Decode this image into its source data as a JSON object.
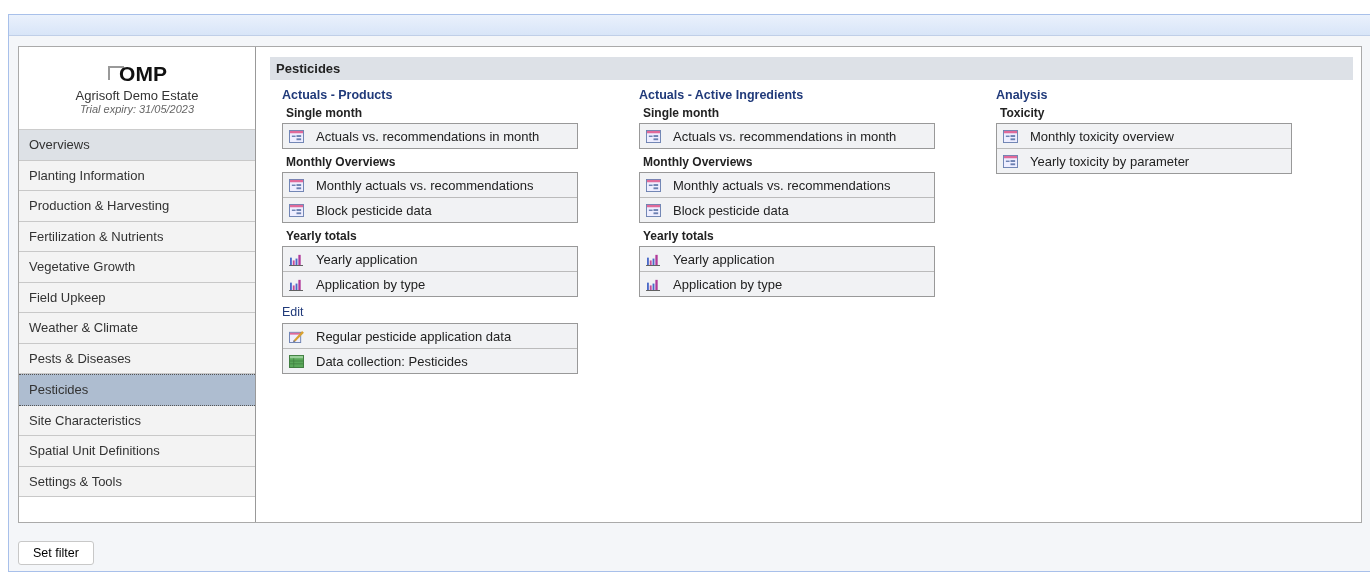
{
  "logo": {
    "text": "OMP"
  },
  "estate": {
    "name": "Agrisoft Demo Estate",
    "trial": "Trial expiry: 31/05/2023"
  },
  "nav": [
    {
      "label": "Overviews",
      "selected": false,
      "hovered": true
    },
    {
      "label": "Planting Information",
      "selected": false,
      "hovered": false
    },
    {
      "label": "Production & Harvesting",
      "selected": false,
      "hovered": false
    },
    {
      "label": "Fertilization & Nutrients",
      "selected": false,
      "hovered": false
    },
    {
      "label": "Vegetative Growth",
      "selected": false,
      "hovered": false
    },
    {
      "label": "Field Upkeep",
      "selected": false,
      "hovered": false
    },
    {
      "label": "Weather & Climate",
      "selected": false,
      "hovered": false
    },
    {
      "label": "Pests & Diseases",
      "selected": false,
      "hovered": false
    },
    {
      "label": "Pesticides",
      "selected": true,
      "hovered": false
    },
    {
      "label": "Site Characteristics",
      "selected": false,
      "hovered": false
    },
    {
      "label": "Spatial Unit Definitions",
      "selected": false,
      "hovered": false
    },
    {
      "label": "Settings & Tools",
      "selected": false,
      "hovered": false
    }
  ],
  "content": {
    "title": "Pesticides",
    "columns": [
      {
        "title": "Actuals - Products",
        "sections": [
          {
            "heading": "Single month",
            "kind": "sub",
            "items": [
              {
                "label": "Actuals vs. recommendations in month",
                "kind": "report"
              }
            ]
          },
          {
            "heading": "Monthly Overviews",
            "kind": "sub",
            "items": [
              {
                "label": "Monthly actuals vs. recommendations",
                "kind": "report"
              },
              {
                "label": "Block pesticide data",
                "kind": "report"
              }
            ]
          },
          {
            "heading": "Yearly totals",
            "kind": "sub",
            "items": [
              {
                "label": "Yearly application",
                "kind": "chart"
              },
              {
                "label": "Application by type",
                "kind": "chart"
              }
            ]
          },
          {
            "heading": "Edit",
            "kind": "group",
            "items": [
              {
                "label": "Regular pesticide application data",
                "kind": "edit"
              },
              {
                "label": "Data collection: Pesticides",
                "kind": "sheet"
              }
            ]
          }
        ]
      },
      {
        "title": "Actuals - Active Ingredients",
        "sections": [
          {
            "heading": "Single month",
            "kind": "sub",
            "items": [
              {
                "label": "Actuals vs. recommendations in month",
                "kind": "report"
              }
            ]
          },
          {
            "heading": "Monthly Overviews",
            "kind": "sub",
            "items": [
              {
                "label": "Monthly actuals vs. recommendations",
                "kind": "report"
              },
              {
                "label": "Block pesticide data",
                "kind": "report"
              }
            ]
          },
          {
            "heading": "Yearly totals",
            "kind": "sub",
            "items": [
              {
                "label": "Yearly application",
                "kind": "chart"
              },
              {
                "label": "Application by type",
                "kind": "chart"
              }
            ]
          }
        ]
      },
      {
        "title": "Analysis",
        "sections": [
          {
            "heading": "Toxicity",
            "kind": "sub",
            "items": [
              {
                "label": "Monthly toxicity overview",
                "kind": "report"
              },
              {
                "label": "Yearly toxicity by parameter",
                "kind": "report"
              }
            ]
          }
        ]
      }
    ]
  },
  "footer": {
    "button": "Set filter"
  }
}
